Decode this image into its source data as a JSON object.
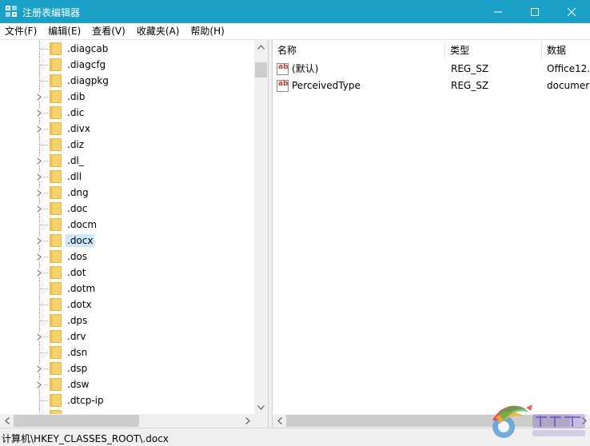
{
  "window": {
    "title": "注册表编辑器"
  },
  "menu": [
    {
      "label": "文件(F)"
    },
    {
      "label": "编辑(E)"
    },
    {
      "label": "查看(V)"
    },
    {
      "label": "收藏夹(A)"
    },
    {
      "label": "帮助(H)"
    }
  ],
  "tree": {
    "items": [
      {
        "label": ".diagcab",
        "expandable": false,
        "selected": false
      },
      {
        "label": ".diagcfg",
        "expandable": false,
        "selected": false
      },
      {
        "label": ".diagpkg",
        "expandable": false,
        "selected": false
      },
      {
        "label": ".dib",
        "expandable": true,
        "selected": false
      },
      {
        "label": ".dic",
        "expandable": true,
        "selected": false
      },
      {
        "label": ".divx",
        "expandable": true,
        "selected": false
      },
      {
        "label": ".diz",
        "expandable": false,
        "selected": false
      },
      {
        "label": ".dl_",
        "expandable": true,
        "selected": false
      },
      {
        "label": ".dll",
        "expandable": true,
        "selected": false
      },
      {
        "label": ".dng",
        "expandable": true,
        "selected": false
      },
      {
        "label": ".doc",
        "expandable": true,
        "selected": false
      },
      {
        "label": ".docm",
        "expandable": false,
        "selected": false
      },
      {
        "label": ".docx",
        "expandable": true,
        "selected": true
      },
      {
        "label": ".dos",
        "expandable": true,
        "selected": false
      },
      {
        "label": ".dot",
        "expandable": true,
        "selected": false
      },
      {
        "label": ".dotm",
        "expandable": false,
        "selected": false
      },
      {
        "label": ".dotx",
        "expandable": false,
        "selected": false
      },
      {
        "label": ".dps",
        "expandable": false,
        "selected": false
      },
      {
        "label": ".drv",
        "expandable": true,
        "selected": false
      },
      {
        "label": ".dsn",
        "expandable": false,
        "selected": false
      },
      {
        "label": ".dsp",
        "expandable": true,
        "selected": false
      },
      {
        "label": ".dsw",
        "expandable": true,
        "selected": false
      },
      {
        "label": ".dtcp-ip",
        "expandable": false,
        "selected": false
      },
      {
        "label": "",
        "expandable": false,
        "selected": false
      }
    ]
  },
  "list": {
    "headers": {
      "name": "名称",
      "type": "类型",
      "data": "数据"
    },
    "rows": [
      {
        "name": "(默认)",
        "type": "REG_SZ",
        "data": "Office12.",
        "icon": "string-value-icon"
      },
      {
        "name": "PerceivedType",
        "type": "REG_SZ",
        "data": "documer",
        "icon": "string-value-icon"
      }
    ]
  },
  "status": {
    "path": "计算机\\HKEY_CLASSES_ROOT\\.docx"
  },
  "colors": {
    "titlebar": "#1ba1c8",
    "selection": "#cce8ff",
    "folder": "#f5d26b"
  }
}
